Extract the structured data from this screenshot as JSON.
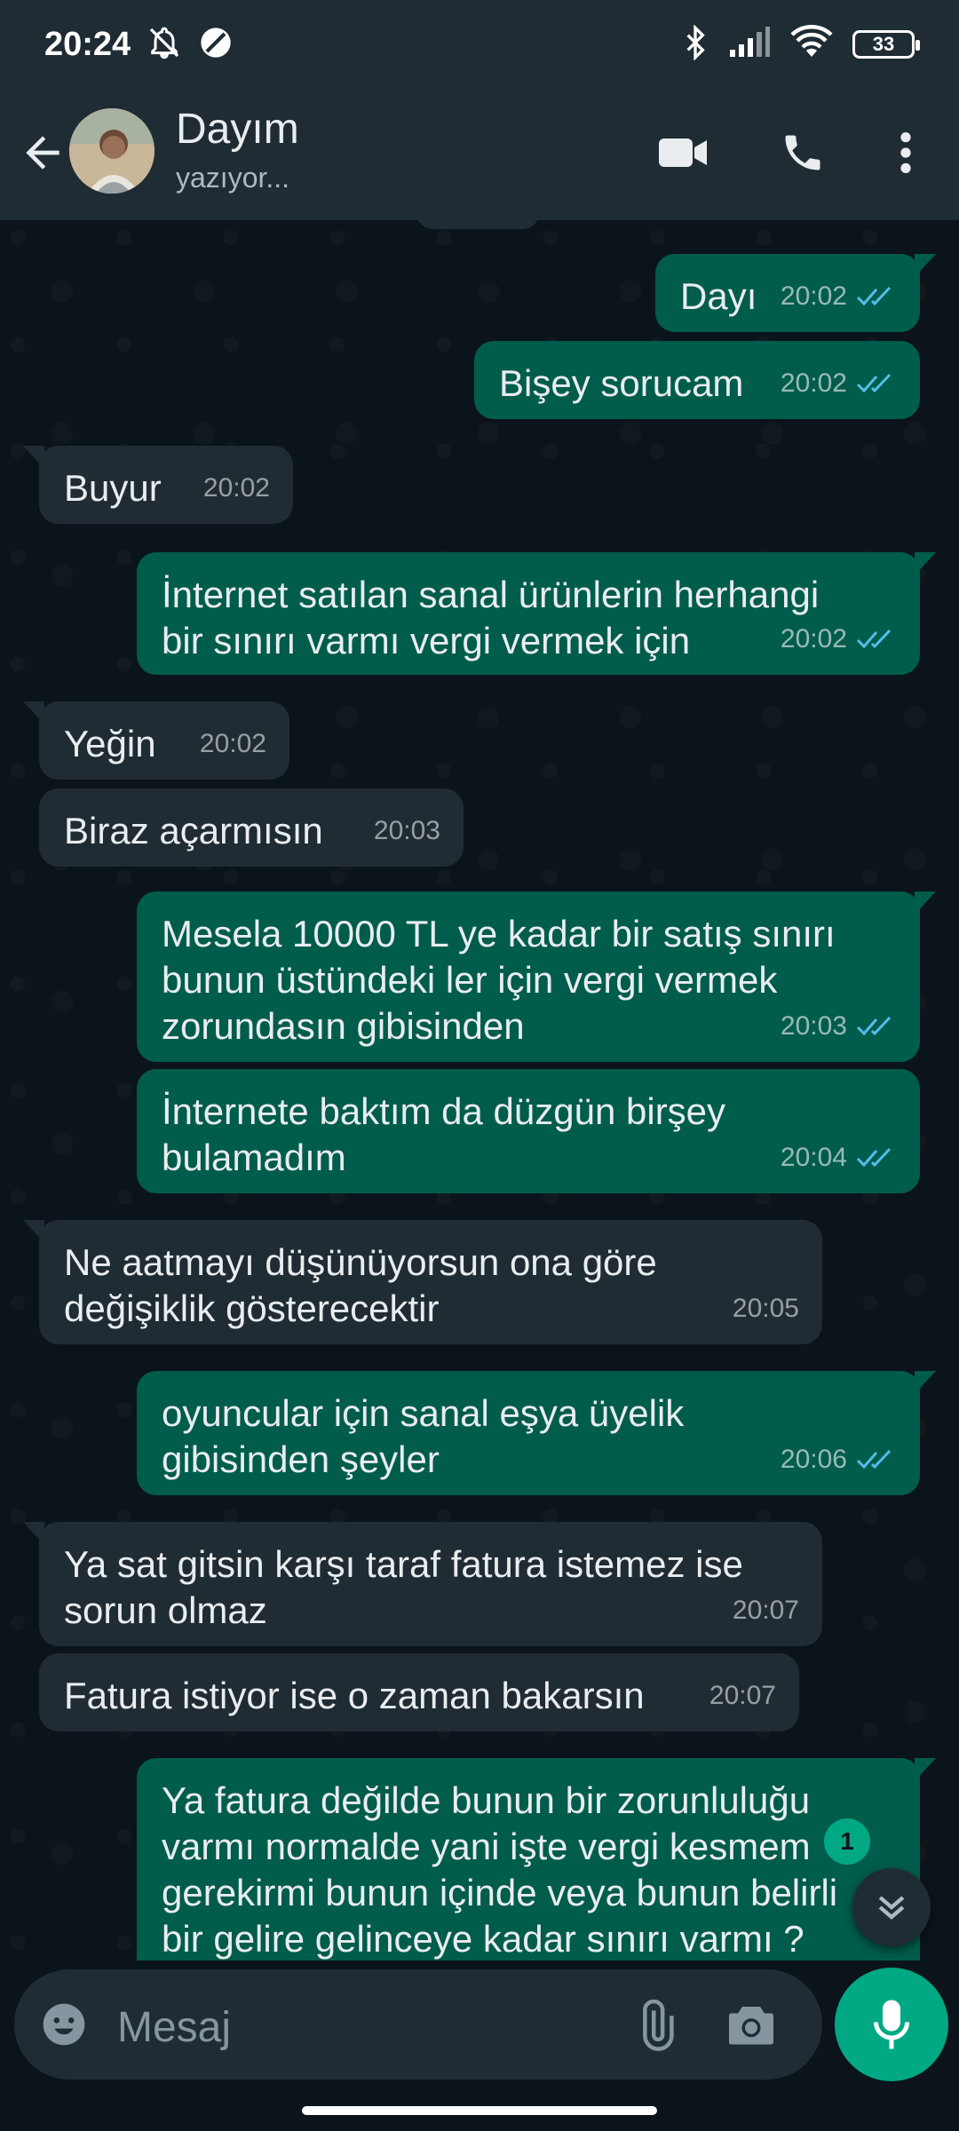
{
  "status_bar": {
    "time": "20:24",
    "battery": "33"
  },
  "header": {
    "contact_name": "Dayım",
    "contact_status": "yazıyor..."
  },
  "messages": [
    {
      "dir": "out",
      "text": "Dayı",
      "time": "20:02",
      "read": true
    },
    {
      "dir": "out",
      "text": "Bişey sorucam",
      "time": "20:02",
      "read": true
    },
    {
      "dir": "in",
      "text": "Buyur",
      "time": "20:02"
    },
    {
      "dir": "out",
      "text": "İnternet satılan sanal ürünlerin herhangi\nbir sınırı varmı vergi vermek için",
      "time": "20:02",
      "read": true
    },
    {
      "dir": "in",
      "text": "Yeğin",
      "time": "20:02"
    },
    {
      "dir": "in",
      "text": "Biraz açarmısın",
      "time": "20:03"
    },
    {
      "dir": "out",
      "text": "Mesela 10000 TL ye kadar bir satış sınırı\nbunun üstündeki ler için vergi vermek\nzorundasın gibisinden",
      "time": "20:03",
      "read": true
    },
    {
      "dir": "out",
      "text": "İnternete baktım da düzgün birşey\nbulamadım",
      "time": "20:04",
      "read": true
    },
    {
      "dir": "in",
      "text": "Ne aatmayı düşünüyorsun ona göre\ndeğişiklik gösterecektir",
      "time": "20:05"
    },
    {
      "dir": "out",
      "text": "oyuncular için sanal eşya üyelik\ngibisinden şeyler",
      "time": "20:06",
      "read": true
    },
    {
      "dir": "in",
      "text": "Ya sat gitsin karşı taraf fatura istemez ise\nsorun olmaz",
      "time": "20:07"
    },
    {
      "dir": "in",
      "text": "Fatura istiyor ise o zaman bakarsın",
      "time": "20:07"
    },
    {
      "dir": "out",
      "text": "Ya fatura değilde bunun bir zorunluluğu\nvarmı normalde yani işte vergi kesmem\ngerekirmi bunun içinde veya bunun belirli\nbir gelire gelinceye kadar sınırı varmı ?",
      "time": "",
      "read": false
    }
  ],
  "unread_count": "1",
  "input": {
    "placeholder": "Mesaj"
  },
  "icons": {
    "back": "back-arrow-icon",
    "video": "video-call-icon",
    "call": "phone-icon",
    "menu": "more-vert-icon",
    "emoji": "emoji-icon",
    "attach": "paperclip-icon",
    "camera": "camera-icon",
    "mic": "mic-icon",
    "scroll": "double-chevron-down-icon"
  },
  "colors": {
    "outgoing_bubble": "#005c4b",
    "incoming_bubble": "#202c33",
    "accent": "#00a884",
    "read_tick": "#53bdeb"
  }
}
